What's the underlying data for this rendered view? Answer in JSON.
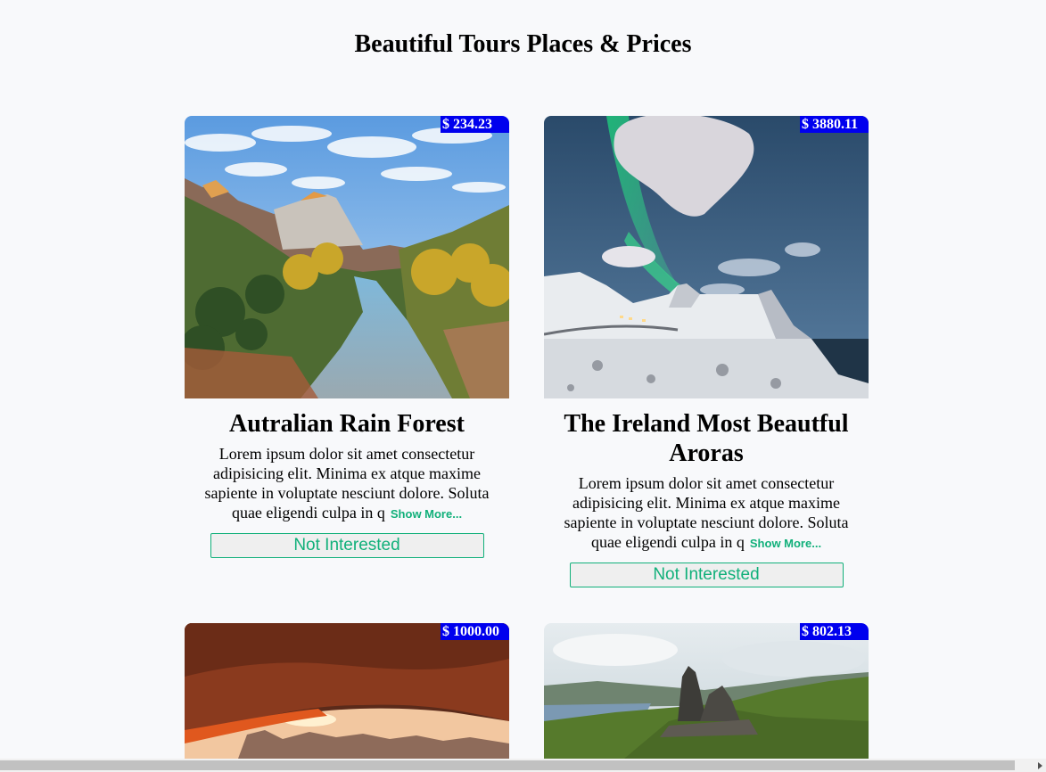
{
  "page": {
    "title": "Beautiful Tours Places & Prices"
  },
  "tours": [
    {
      "price": "$ 234.23",
      "title": "Autralian Rain Forest",
      "description": "Lorem ipsum dolor sit amet consectetur adipisicing elit. Minima ex atque maxime sapiente in voluptate nesciunt dolore. Soluta quae eligendi culpa in q",
      "show_more": "Show More...",
      "button": "Not Interested"
    },
    {
      "price": "$ 3880.11",
      "title": "The Ireland Most Beautful Aroras",
      "description": "Lorem ipsum dolor sit amet consectetur adipisicing elit. Minima ex atque maxime sapiente in voluptate nesciunt dolore. Soluta quae eligendi culpa in q",
      "show_more": "Show More...",
      "button": "Not Interested"
    },
    {
      "price": "$ 1000.00"
    },
    {
      "price": "$ 802.13"
    }
  ],
  "colors": {
    "price_bg": "#0000ee",
    "accent": "#11b07a",
    "background": "#f8f9fb"
  }
}
